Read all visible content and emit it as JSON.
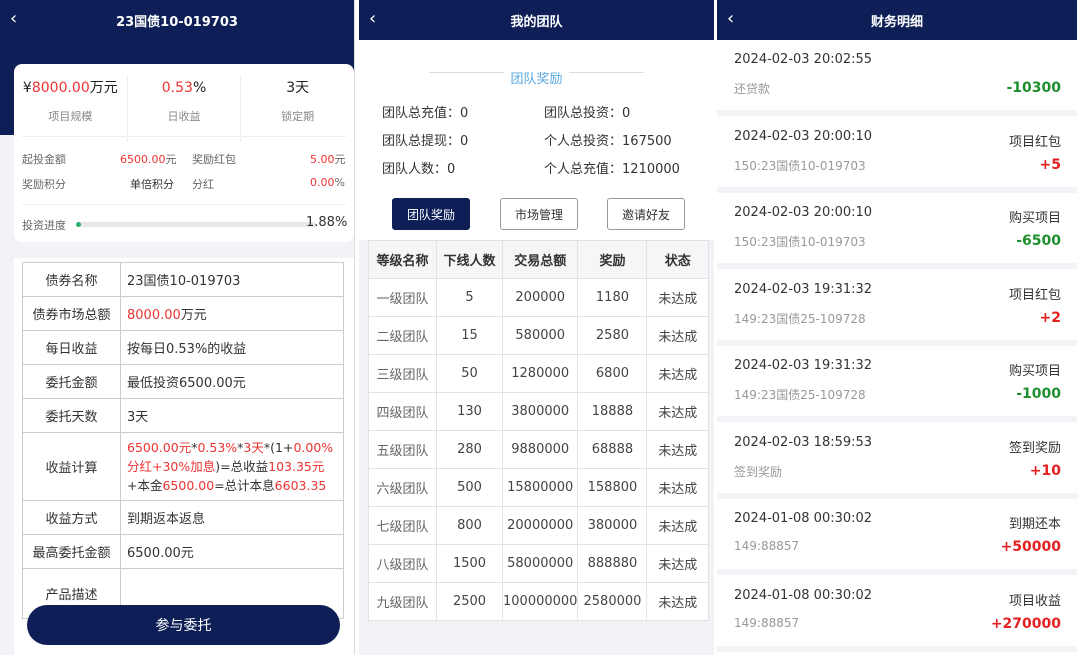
{
  "left": {
    "title": "23国债10-019703",
    "back_icon": "‹",
    "stats": [
      {
        "prefix": "¥",
        "value": "8000.00",
        "unit": "万元",
        "label": "项目规模"
      },
      {
        "prefix": "",
        "value": "0.53",
        "unit": "%",
        "label": "日收益"
      },
      {
        "prefix": "",
        "value": "3天",
        "unit": "",
        "label": "锁定期"
      }
    ],
    "kv": {
      "min_invest_label": "起投金额",
      "min_invest_value": "6500.00",
      "bonus_label": "奖励红包",
      "bonus_value": "5.00",
      "points_label": "奖励积分",
      "points_value": "单倍积分",
      "dividend_label": "分红",
      "dividend_value": "0.00",
      "progress_label": "投资进度",
      "progress_value": "1.88%",
      "currency_unit": "元",
      "percent_unit": "%"
    },
    "progress": 0.0188,
    "rows": [
      {
        "k": "债券名称",
        "v": "23国债10-019703"
      },
      {
        "k": "债券市场总额",
        "v1": "8000.00",
        "v2": "万元"
      },
      {
        "k": "每日收益",
        "v": "按每日0.53%的收益"
      },
      {
        "k": "委托金额",
        "v": "最低投资6500.00元"
      },
      {
        "k": "委托天数",
        "v": "3天"
      },
      {
        "k": "收益计算",
        "parts": [
          "6500.00元",
          "*",
          "0.53%",
          "*",
          "3天",
          "*(1+",
          "0.00%",
          "分红+30%加息",
          ")=总收益",
          "103.35元",
          "+本金",
          "6500.00",
          "=总计本息",
          "6603.35"
        ]
      },
      {
        "k": "收益方式",
        "v": "到期返本返息"
      },
      {
        "k": "最高委托金额",
        "v": "6500.00元"
      },
      {
        "k": "产品描述",
        "v": ""
      }
    ],
    "join_button": "参与委托"
  },
  "middle": {
    "title": "我的团队",
    "back_icon": "‹",
    "section_title": "团队奖励",
    "summary": [
      {
        "label": "团队总充值",
        "value": "0"
      },
      {
        "label": "团队总投资",
        "value": "0"
      },
      {
        "label": "团队总提现",
        "value": "0"
      },
      {
        "label": "个人总投资",
        "value": "167500"
      },
      {
        "label": "团队人数",
        "value": "0"
      },
      {
        "label": "个人总充值",
        "value": "1210000"
      }
    ],
    "tabs": [
      "团队奖励",
      "市场管理",
      "邀请好友"
    ],
    "table_headers": [
      "等级名称",
      "下线人数",
      "交易总额",
      "奖励",
      "状态"
    ],
    "table_rows": [
      [
        "一级团队",
        "5",
        "200000",
        "1180",
        "未达成"
      ],
      [
        "二级团队",
        "15",
        "580000",
        "2580",
        "未达成"
      ],
      [
        "三级团队",
        "50",
        "1280000",
        "6800",
        "未达成"
      ],
      [
        "四级团队",
        "130",
        "3800000",
        "18888",
        "未达成"
      ],
      [
        "五级团队",
        "280",
        "9880000",
        "68888",
        "未达成"
      ],
      [
        "六级团队",
        "500",
        "15800000",
        "158800",
        "未达成"
      ],
      [
        "七级团队",
        "800",
        "20000000",
        "380000",
        "未达成"
      ],
      [
        "八级团队",
        "1500",
        "58000000",
        "888880",
        "未达成"
      ],
      [
        "九级团队",
        "2500",
        "100000000",
        "2580000",
        "未达成"
      ]
    ]
  },
  "right": {
    "title": "财务明细",
    "back_icon": "‹",
    "records": [
      {
        "time": "2024-02-03 20:02:55",
        "desc": "还贷款",
        "type": "",
        "amount": "-10300",
        "sign": "neg"
      },
      {
        "time": "2024-02-03 20:00:10",
        "desc": "150:23国债10-019703",
        "type": "项目红包",
        "amount": "+5",
        "sign": "pos"
      },
      {
        "time": "2024-02-03 20:00:10",
        "desc": "150:23国债10-019703",
        "type": "购买项目",
        "amount": "-6500",
        "sign": "neg"
      },
      {
        "time": "2024-02-03 19:31:32",
        "desc": "149:23国债25-109728",
        "type": "项目红包",
        "amount": "+2",
        "sign": "pos"
      },
      {
        "time": "2024-02-03 19:31:32",
        "desc": "149:23国债25-109728",
        "type": "购买项目",
        "amount": "-1000",
        "sign": "neg"
      },
      {
        "time": "2024-02-03 18:59:53",
        "desc": "签到奖励",
        "type": "签到奖励",
        "amount": "+10",
        "sign": "pos"
      },
      {
        "time": "2024-01-08 00:30:02",
        "desc": "149:88857",
        "type": "到期还本",
        "amount": "+50000",
        "sign": "pos"
      },
      {
        "time": "2024-01-08 00:30:02",
        "desc": "149:88857",
        "type": "项目收益",
        "amount": "+270000",
        "sign": "pos"
      }
    ],
    "colors": {
      "positive": "#e52020",
      "negative": "#1e8f2e"
    }
  }
}
